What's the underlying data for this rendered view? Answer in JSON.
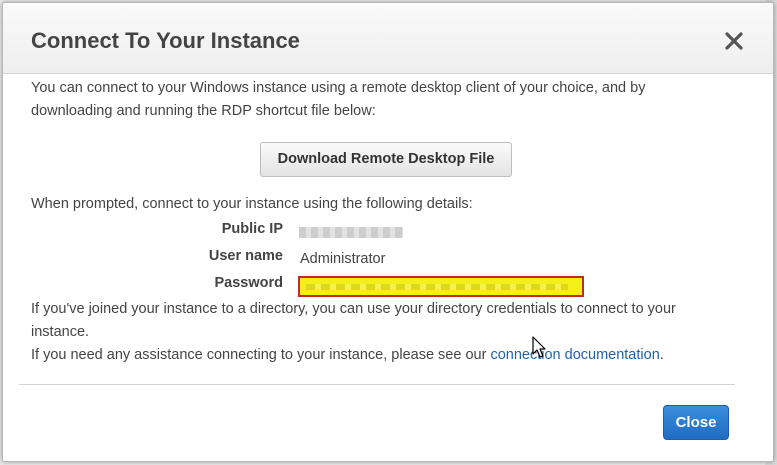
{
  "dialog": {
    "title": "Connect To Your Instance",
    "intro_line_1": "You can connect to your Windows instance using a remote desktop client of your choice, and by",
    "intro_line_2": "downloading and running the RDP shortcut file below:",
    "download_button_label": "Download Remote Desktop File",
    "prompt_text": "When prompted, connect to your instance using the following details:",
    "details": {
      "public_ip_label": "Public IP",
      "username_label": "User name",
      "username_value": "Administrator",
      "password_label": "Password"
    },
    "directory_line_1": "If you've joined your instance to a directory, you can use your directory credentials to connect to your",
    "directory_line_2": "instance.",
    "assistance_prefix": "If you need any assistance connecting to your instance, please see our",
    "assistance_link": "connection documentation",
    "assistance_suffix": ".",
    "close_button_label": "Close"
  },
  "icons": {
    "close": "close-icon",
    "cursor": "mouse-pointer-icon"
  },
  "colors": {
    "primary_button": "#2a7bd0",
    "link": "#1f62b0",
    "highlight": "#f2ef1a",
    "highlight_border": "#c62828"
  }
}
